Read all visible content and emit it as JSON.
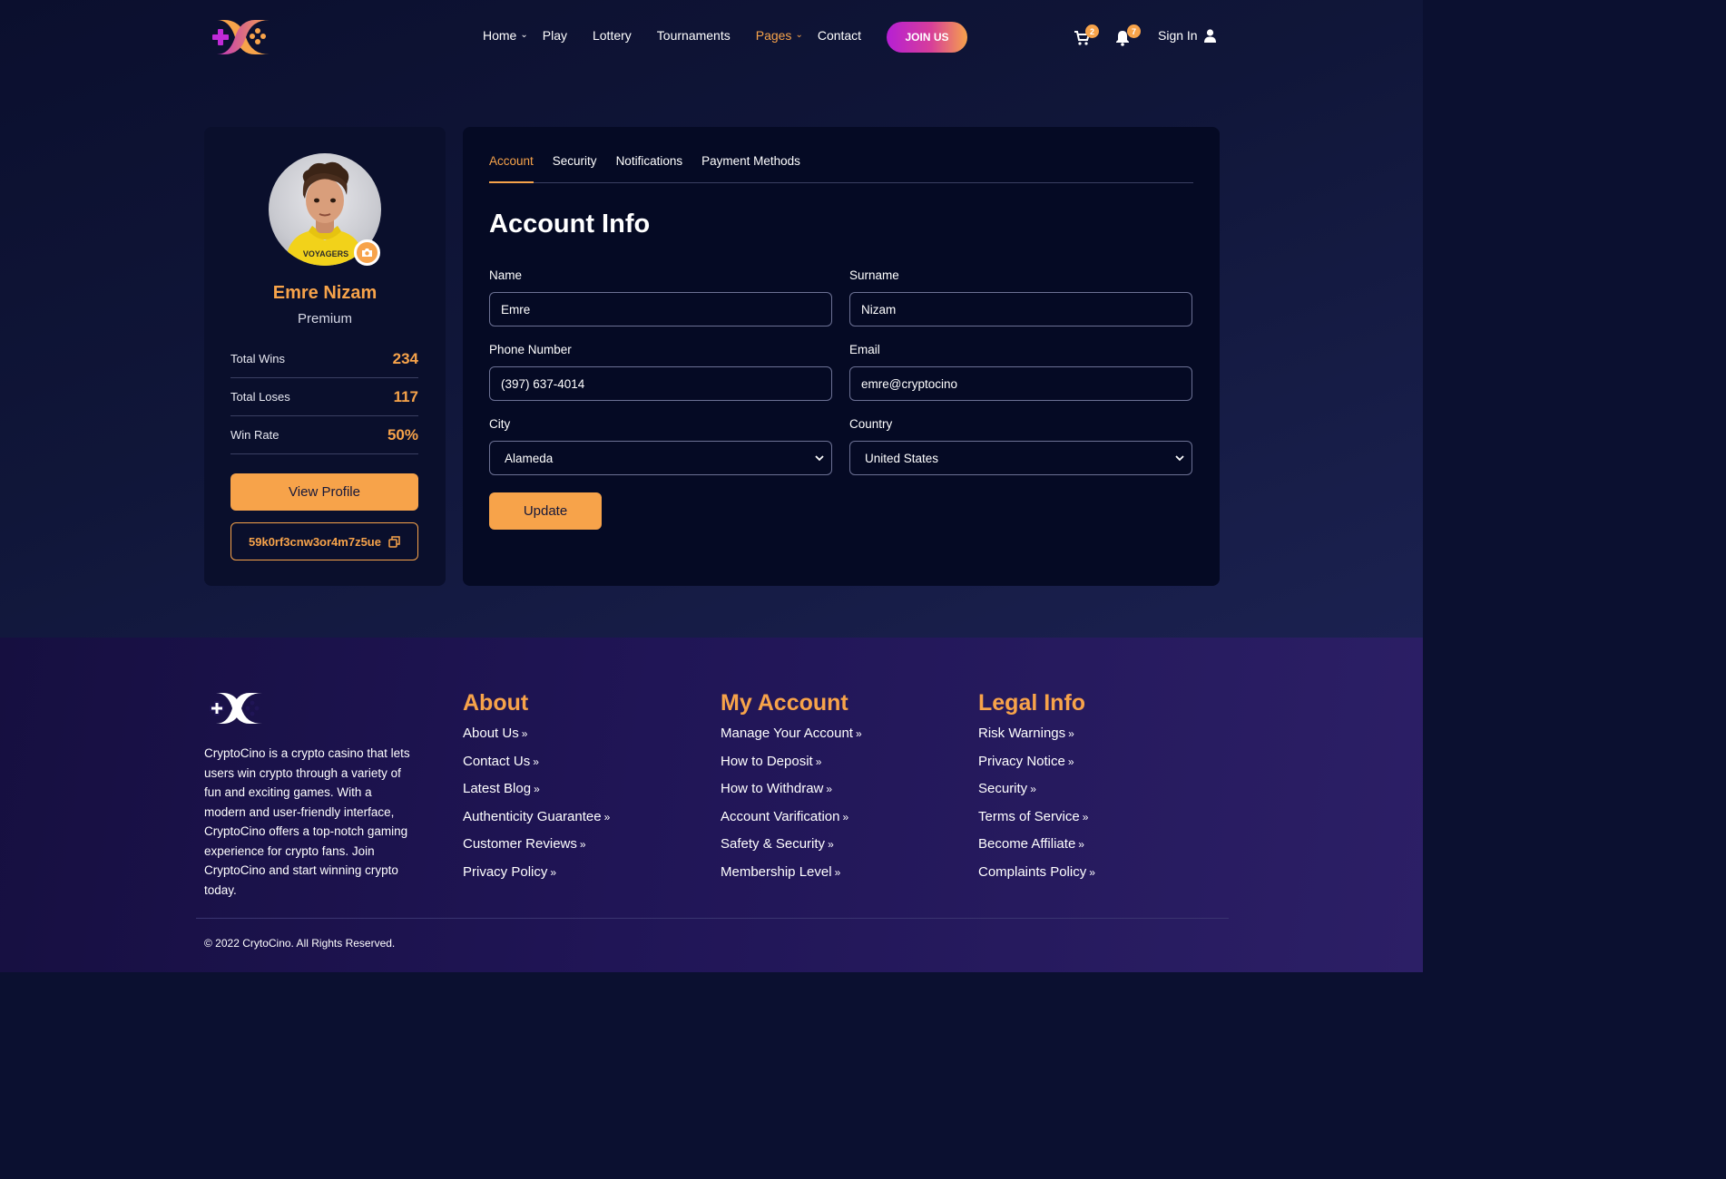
{
  "header": {
    "nav": [
      {
        "label": "Home",
        "has_dropdown": true,
        "active": false
      },
      {
        "label": "Play",
        "has_dropdown": false,
        "active": false
      },
      {
        "label": "Lottery",
        "has_dropdown": false,
        "active": false
      },
      {
        "label": "Tournaments",
        "has_dropdown": false,
        "active": false
      },
      {
        "label": "Pages",
        "has_dropdown": true,
        "active": true
      },
      {
        "label": "Contact",
        "has_dropdown": false,
        "active": false
      }
    ],
    "join_label": "JOIN US",
    "cart_icon": "cart-icon",
    "cart_count": "2",
    "bell_icon": "bell-icon",
    "notification_count": "7",
    "signin_label": "Sign In",
    "user_icon": "user-icon"
  },
  "profile": {
    "name": "Emre Nizam",
    "tier": "Premium",
    "stats": [
      {
        "label": "Total Wins",
        "value": "234"
      },
      {
        "label": "Total Loses",
        "value": "117"
      },
      {
        "label": "Win Rate",
        "value": "50%"
      }
    ],
    "view_profile_label": "View Profile",
    "wallet_code": "59k0rf3cnw3or4m7z5ue",
    "hoodie_text": "VOYAGERS"
  },
  "account": {
    "tabs": [
      {
        "label": "Account",
        "active": true
      },
      {
        "label": "Security",
        "active": false
      },
      {
        "label": "Notifications",
        "active": false
      },
      {
        "label": "Payment Methods",
        "active": false
      }
    ],
    "title": "Account Info",
    "fields": {
      "name": {
        "label": "Name",
        "value": "Emre"
      },
      "surname": {
        "label": "Surname",
        "value": "Nizam"
      },
      "phone": {
        "label": "Phone Number",
        "value": "(397) 637-4014"
      },
      "email": {
        "label": "Email",
        "value": "emre@cryptocino"
      },
      "city": {
        "label": "City",
        "value": "Alameda"
      },
      "country": {
        "label": "Country",
        "value": "United States"
      }
    },
    "update_label": "Update"
  },
  "footer": {
    "description": "CryptoCino is a crypto casino that lets users win crypto through a variety of fun and exciting games. With a modern and user-friendly interface, CryptoCino offers a top-notch gaming experience for crypto fans. Join CryptoCino and start winning crypto today.",
    "columns": [
      {
        "title": "About",
        "links": [
          "About Us",
          "Contact Us",
          "Latest Blog",
          "Authenticity Guarantee",
          "Customer Reviews",
          "Privacy Policy"
        ]
      },
      {
        "title": "My Account",
        "links": [
          "Manage Your Account",
          "How to Deposit",
          "How to Withdraw",
          "Account Varification",
          "Safety & Security",
          "Membership Level"
        ]
      },
      {
        "title": "Legal Info",
        "links": [
          "Risk Warnings",
          "Privacy Notice",
          "Security",
          "Terms of Service",
          "Become Affiliate",
          "Complaints Policy"
        ]
      }
    ],
    "copyright": "© 2022 CrytoCino. All Rights Reserved."
  },
  "colors": {
    "accent": "#f7a34a",
    "join_gradient_start": "#b61fd4",
    "join_gradient_end": "#f6a24b",
    "background_dark": "#0b0f2e",
    "footer_purple": "#201556"
  }
}
